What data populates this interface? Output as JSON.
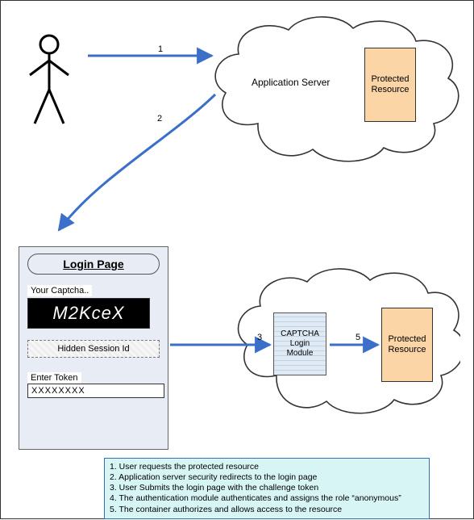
{
  "actor": {
    "name": "user"
  },
  "cloud_top": {
    "label": "Application Server",
    "protected_label": "Protected Resource"
  },
  "cloud_bottom": {
    "protected_label": "Protected Resource"
  },
  "login_page": {
    "title": "Login Page",
    "captcha_label": "Your Captcha..",
    "captcha_text": "M2KceX",
    "hidden_label": "Hidden Session Id",
    "token_label": "Enter Token",
    "token_value": "XXXXXXXX"
  },
  "captcha_module": {
    "label": "CAPTCHA Login Module"
  },
  "arrows": {
    "s1": "1",
    "s2": "2",
    "s3": "3",
    "s5": "5"
  },
  "legend": {
    "l1": "1. User requests the protected resource",
    "l2": "2. Application server security redirects to the login page",
    "l3": "3. User Submits the login page with the challenge token",
    "l4": "4. The authentication module authenticates and assigns the role “anonymous”",
    "l5": "5. The container authorizes and allows access to the resource"
  }
}
